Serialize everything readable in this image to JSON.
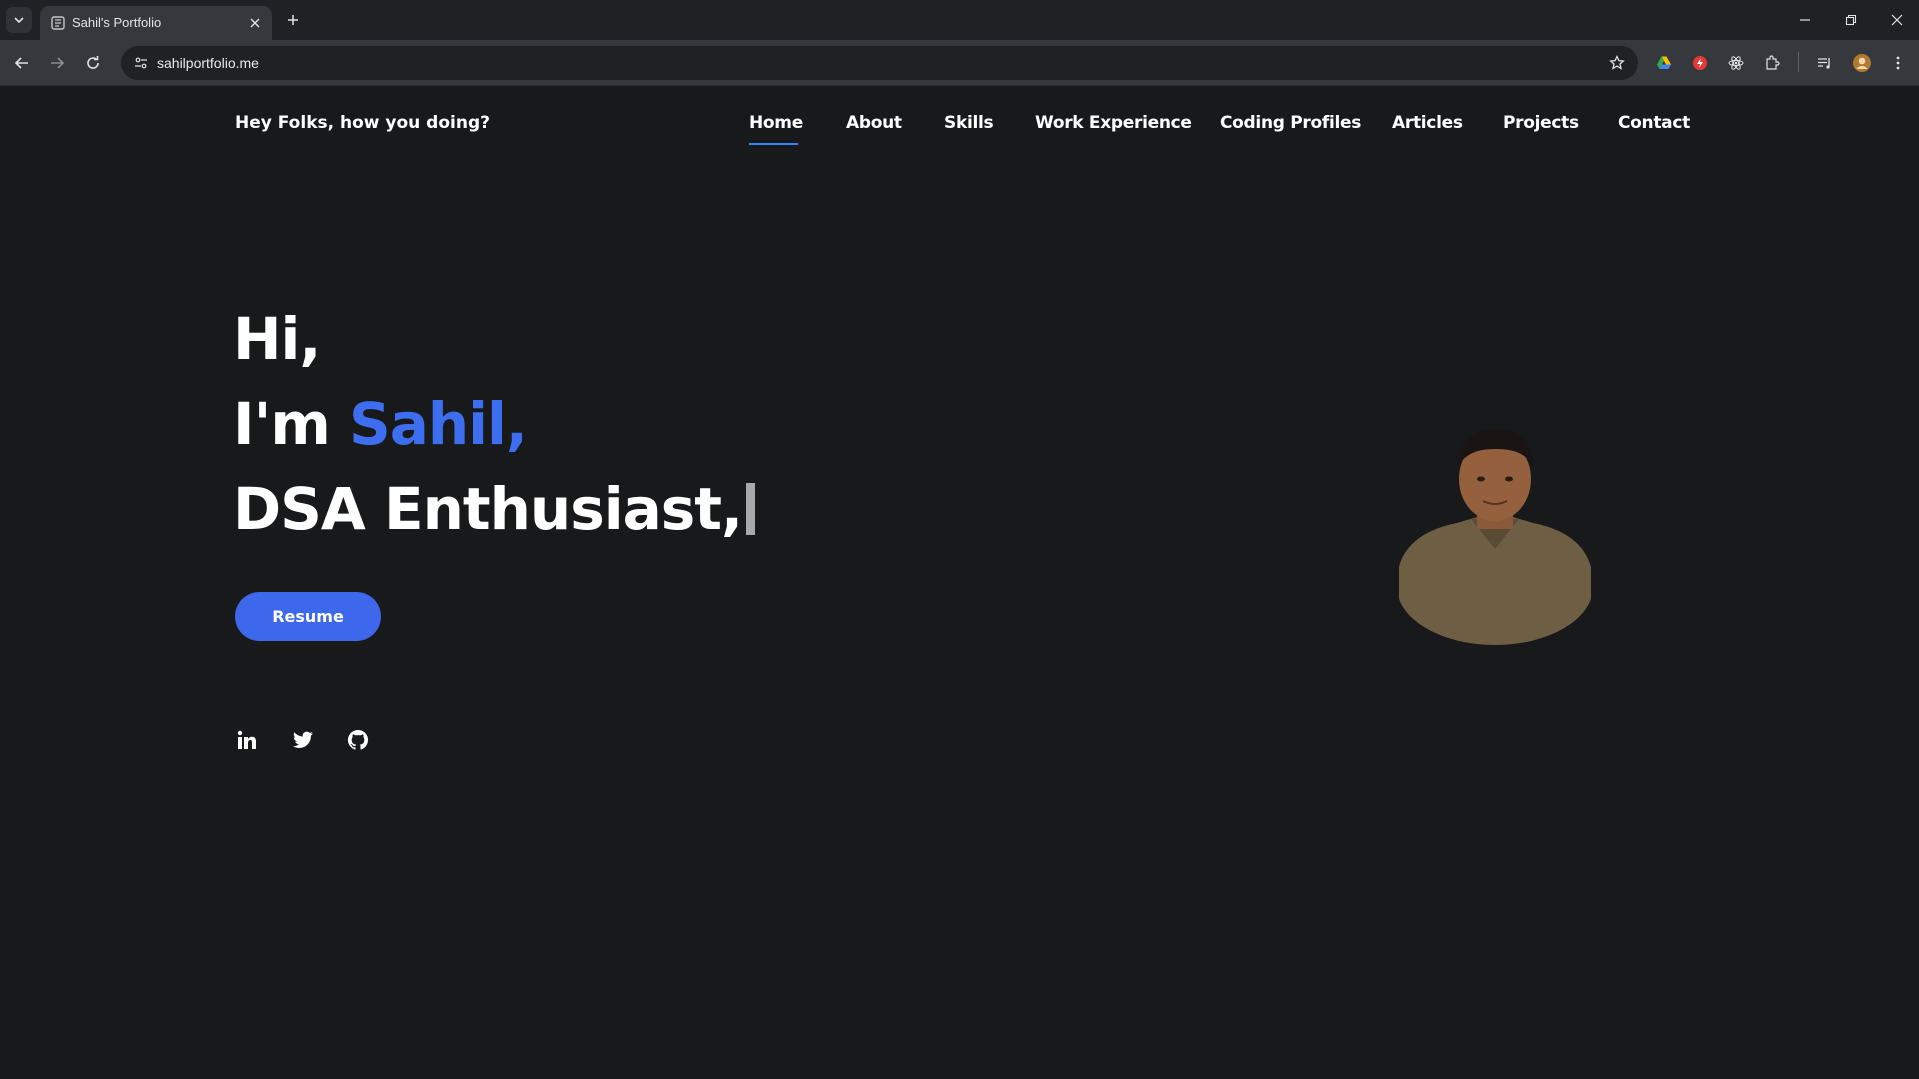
{
  "browser": {
    "tab_title": "Sahil's Portfolio",
    "url": "sahilportfolio.me"
  },
  "site": {
    "greeting": "Hey Folks, how you doing?",
    "nav": [
      {
        "label": "Home",
        "active": true
      },
      {
        "label": "About"
      },
      {
        "label": "Skills"
      },
      {
        "label": "Work Experience"
      },
      {
        "label": "Coding Profiles"
      },
      {
        "label": "Articles"
      },
      {
        "label": "Projects"
      },
      {
        "label": "Contact"
      }
    ],
    "hero": {
      "line1": "Hi,",
      "line2_prefix": "I'm ",
      "line2_name": "Sahil,",
      "line3": "DSA Enthusiast,"
    },
    "resume_label": "Resume",
    "social": [
      "linkedin-icon",
      "twitter-icon",
      "github-icon"
    ],
    "accent_color": "#3d6ef0"
  }
}
